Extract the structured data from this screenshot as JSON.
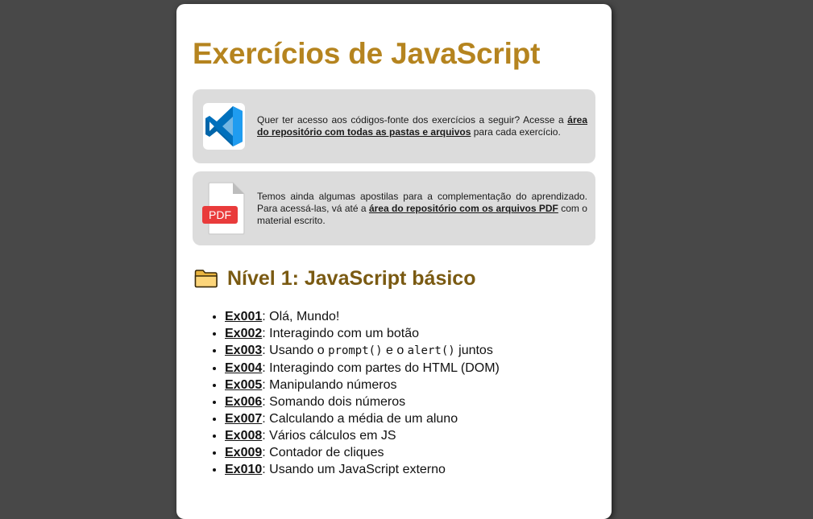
{
  "page": {
    "title": "Exercícios de JavaScript"
  },
  "info_boxes": {
    "code": {
      "icon": "vscode-icon",
      "text_before": "Quer ter acesso aos códigos-fonte dos exercícios a seguir? Acesse a ",
      "link_text": "área do repositório com todas as pastas e arquivos",
      "text_after": " para cada exercício."
    },
    "pdf": {
      "icon": "pdf-file-icon",
      "icon_label": "PDF",
      "text_before": "Temos ainda algumas apostilas para a complementação do aprendizado. Para acessá-las, vá até a ",
      "link_text": "área do repositório com os arquivos PDF",
      "text_after": " com o material escrito."
    }
  },
  "section": {
    "icon": "folder-icon",
    "title": "Nível 1: JavaScript básico"
  },
  "exercises": [
    {
      "id": "Ex001",
      "sep": ": ",
      "desc": "Olá, Mundo!"
    },
    {
      "id": "Ex002",
      "sep": ": ",
      "desc": "Interagindo com um botão"
    },
    {
      "id": "Ex003",
      "sep": ": ",
      "desc_a": "Usando o ",
      "code_a": "prompt()",
      "desc_b": " e o ",
      "code_b": "alert()",
      "desc_c": " juntos"
    },
    {
      "id": "Ex004",
      "sep": ": ",
      "desc": "Interagindo com partes do HTML (DOM)"
    },
    {
      "id": "Ex005",
      "sep": ": ",
      "desc": "Manipulando números"
    },
    {
      "id": "Ex006",
      "sep": ": ",
      "desc": "Somando dois números"
    },
    {
      "id": "Ex007",
      "sep": ": ",
      "desc": "Calculando a média de um aluno"
    },
    {
      "id": "Ex008",
      "sep": ": ",
      "desc": "Vários cálculos em JS"
    },
    {
      "id": "Ex009",
      "sep": ": ",
      "desc": "Contador de cliques"
    },
    {
      "id": "Ex010",
      "sep": ": ",
      "desc": "Usando um JavaScript externo"
    }
  ],
  "colors": {
    "background": "#484848",
    "title": "#b5841f",
    "section_title": "#7a5a12",
    "box": "#dcdcdc"
  }
}
